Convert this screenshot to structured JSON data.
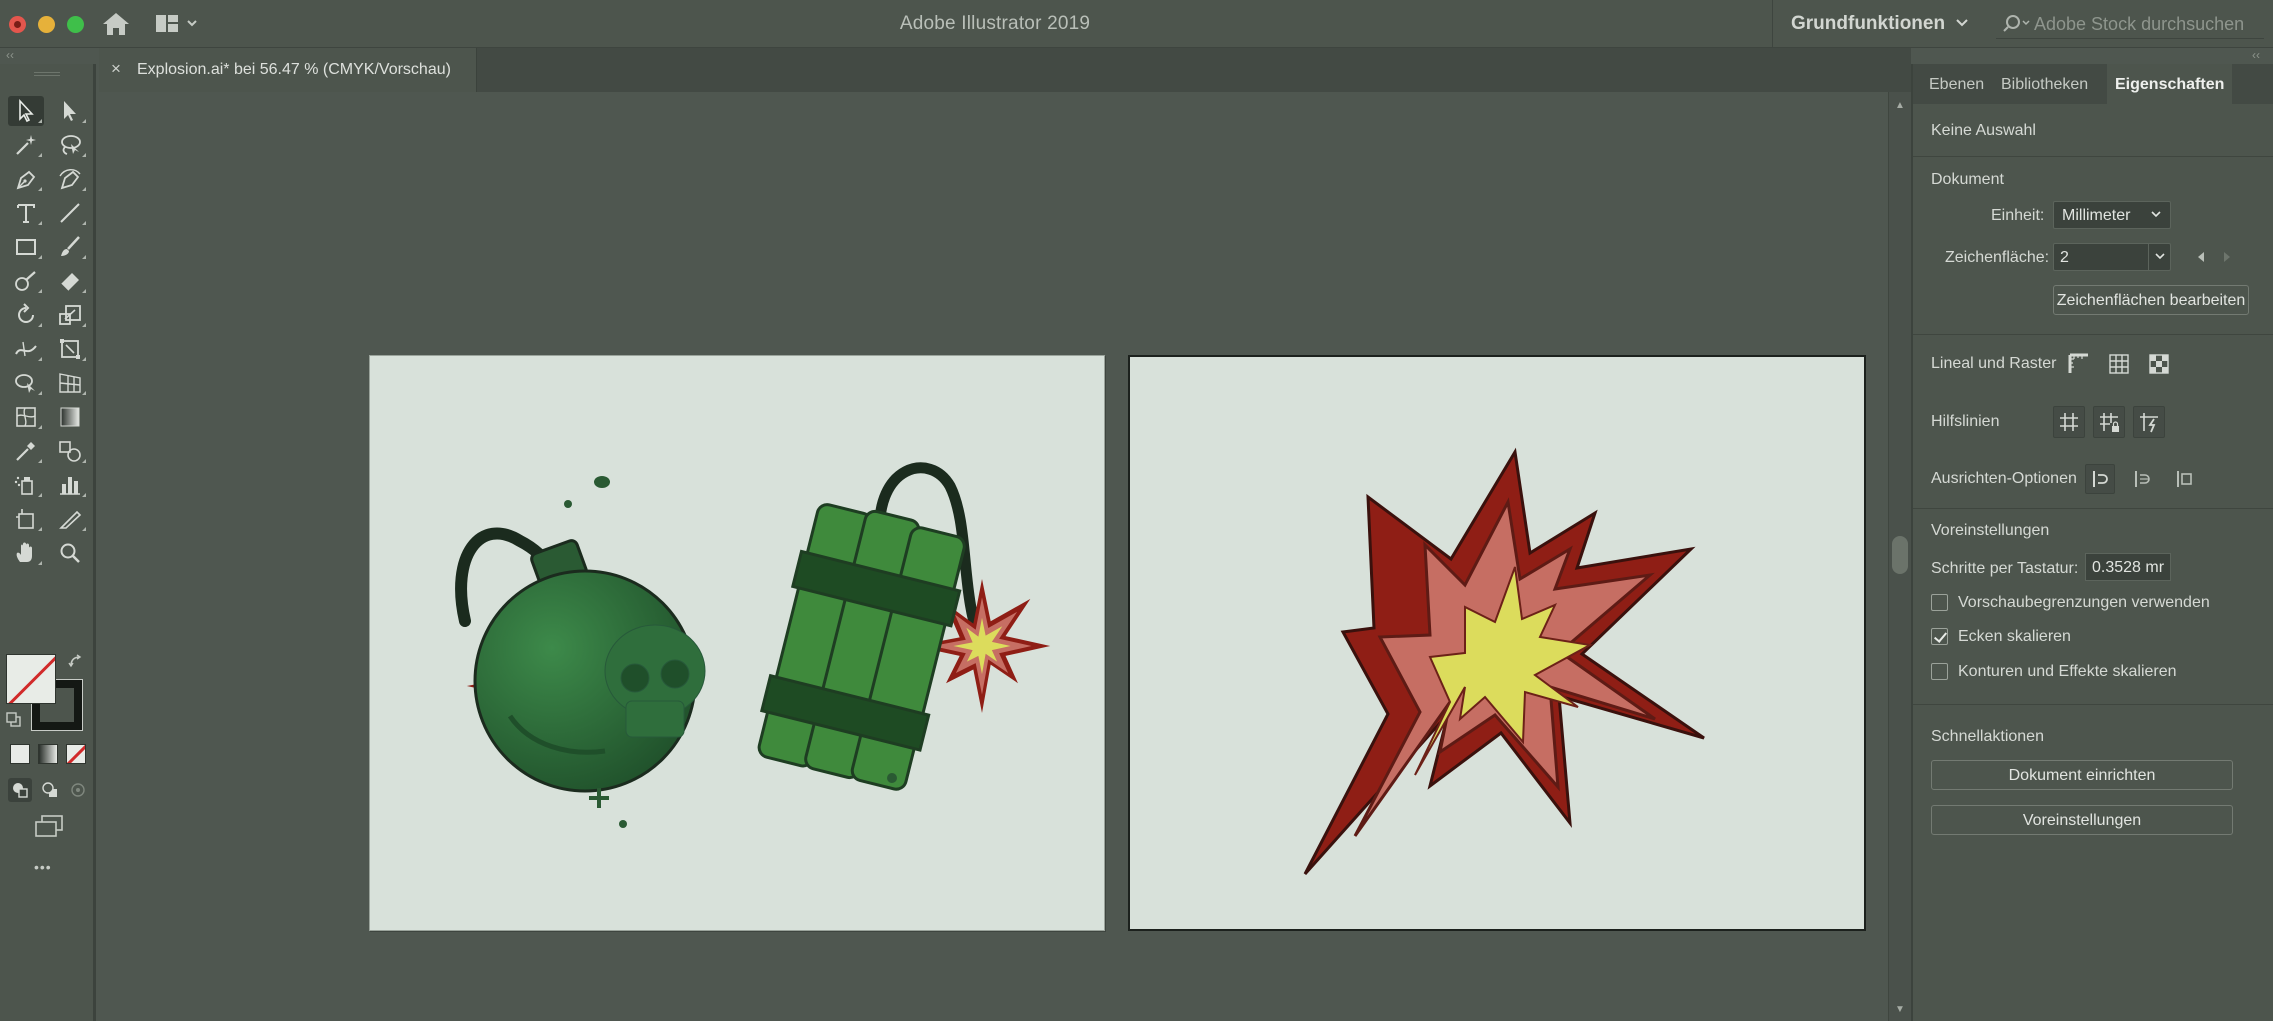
{
  "app": {
    "title": "Adobe Illustrator 2019",
    "workspace": "Grundfunktionen",
    "stock_search_placeholder": "Adobe Stock durchsuchen"
  },
  "document_tab": {
    "close_glyph": "×",
    "title": "Explosion.ai* bei 56.47 % (CMYK/Vorschau)"
  },
  "toolbar": {
    "more_glyph": "•••"
  },
  "panel": {
    "tabs": [
      {
        "label": "Ebenen",
        "active": false
      },
      {
        "label": "Bibliotheken",
        "active": false
      },
      {
        "label": "Eigenschaften",
        "active": true
      }
    ],
    "selection_status": "Keine Auswahl",
    "document": {
      "title": "Dokument",
      "unit_label": "Einheit:",
      "unit_value": "Millimeter",
      "artboard_label": "Zeichenfläche:",
      "artboard_value": "2",
      "edit_artboards_button": "Zeichenflächen bearbeiten"
    },
    "ruler_grid_label": "Lineal und Raster",
    "guides_label": "Hilfslinien",
    "align_options_label": "Ausrichten-Optionen",
    "preferences": {
      "title": "Voreinstellungen",
      "keyboard_increment_label": "Schritte per Tastatur:",
      "keyboard_increment_value": "0.3528 mr",
      "checkboxes": [
        {
          "label": "Vorschaubegrenzungen verwenden",
          "checked": false
        },
        {
          "label": "Ecken skalieren",
          "checked": true
        },
        {
          "label": "Konturen und Effekte skalieren",
          "checked": false
        }
      ]
    },
    "quick_actions": {
      "title": "Schnellaktionen",
      "setup_document_button": "Dokument einrichten",
      "preferences_button": "Voreinstellungen"
    }
  },
  "colors": {
    "artboard_bg": "#d8e1da",
    "bomb_green": "#2f6e3c",
    "dynamite_green": "#3f8a3c",
    "explosion_dark_red": "#8f1e15",
    "explosion_pink": "#c66e63",
    "explosion_yellow": "#dcdc5c"
  }
}
